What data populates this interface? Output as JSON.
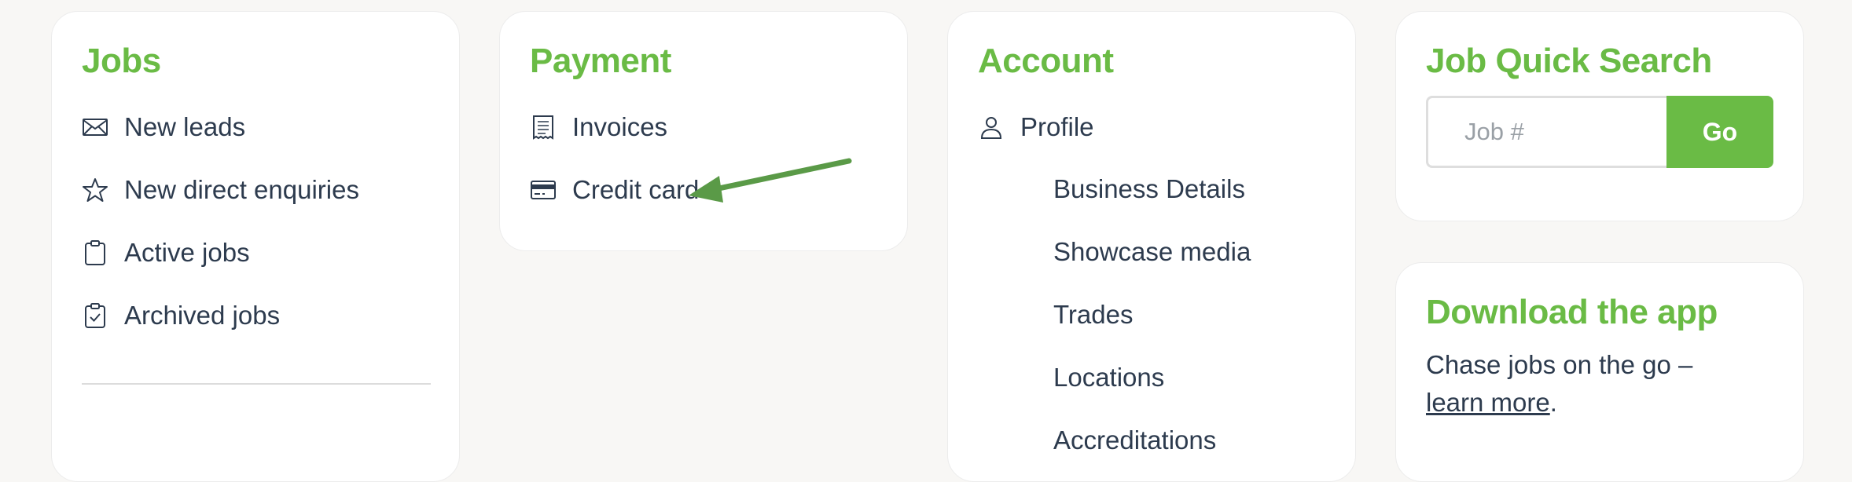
{
  "jobs": {
    "title": "Jobs",
    "items": [
      {
        "label": "New leads",
        "icon": "envelope-icon"
      },
      {
        "label": "New direct enquiries",
        "icon": "star-icon"
      },
      {
        "label": "Active jobs",
        "icon": "clipboard-icon"
      },
      {
        "label": "Archived jobs",
        "icon": "clipboard-check-icon"
      }
    ]
  },
  "payment": {
    "title": "Payment",
    "items": [
      {
        "label": "Invoices",
        "icon": "receipt-icon"
      },
      {
        "label": "Credit card",
        "icon": "credit-card-icon"
      }
    ]
  },
  "account": {
    "title": "Account",
    "profile": {
      "label": "Profile",
      "icon": "user-icon"
    },
    "sub_items": [
      "Business Details",
      "Showcase media",
      "Trades",
      "Locations",
      "Accreditations"
    ]
  },
  "quick_search": {
    "title": "Job Quick Search",
    "placeholder": "Job #",
    "value": "",
    "button_label": "Go"
  },
  "download_app": {
    "title": "Download the app",
    "text_before": "Chase jobs on the go – ",
    "link_label": "learn more",
    "text_after": "."
  },
  "colors": {
    "accent": "#6abb45",
    "text": "#2d3b4e",
    "annotation_arrow": "#5a9a47"
  }
}
